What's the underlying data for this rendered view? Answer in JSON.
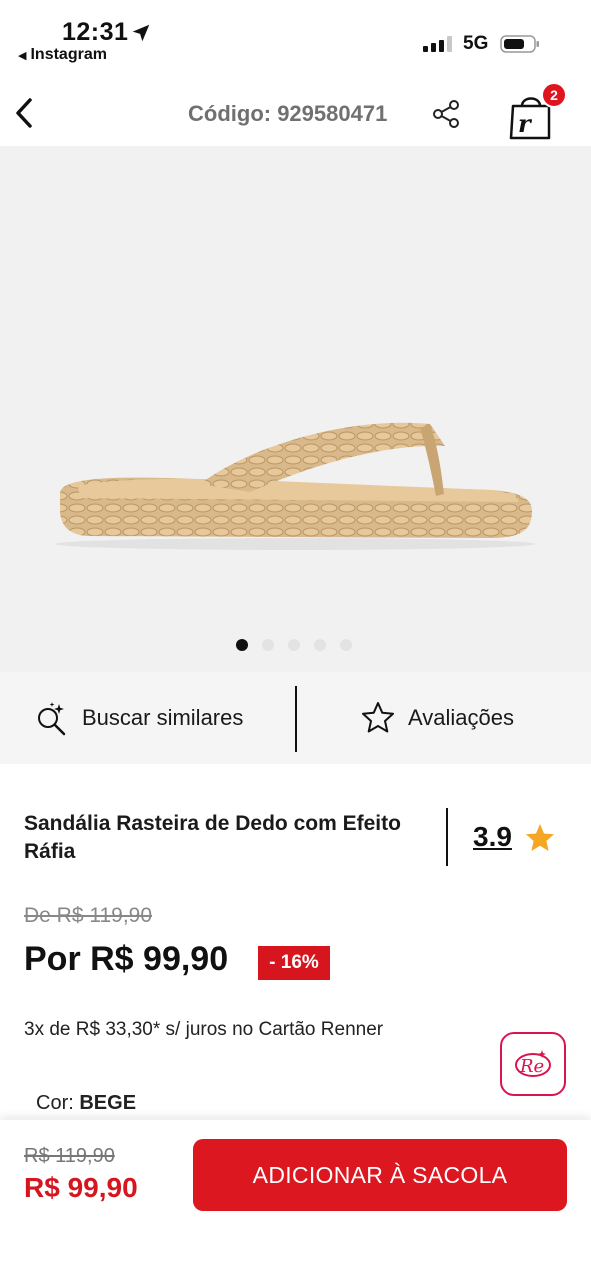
{
  "status_bar": {
    "time": "12:31",
    "back_app": "Instagram",
    "network": "5G"
  },
  "header": {
    "code_label": "Código: 929580471",
    "cart_count": "2"
  },
  "gallery": {
    "image_description": "Sandália rasteira bege com efeito ráfia trançada",
    "total_images": 5,
    "active_index": 0
  },
  "actions": {
    "similar_label": "Buscar similares",
    "reviews_label": "Avaliações"
  },
  "product": {
    "title": "Sandália Rasteira de Dedo com Efeito Ráfia",
    "rating": "3.9",
    "old_price": "De R$ 119,90",
    "new_price": "Por R$ 99,90",
    "discount": "- 16%",
    "installments": "3x de R$ 33,30* s/ juros no Cartão Renner",
    "color_label": "Cor:",
    "color_value": "BEGE"
  },
  "bottom_bar": {
    "old_price": "R$ 119,90",
    "new_price": "R$ 99,90",
    "add_button": "ADICIONAR À SACOLA"
  },
  "colors": {
    "accent": "#dc1720",
    "badge": "#e0141e",
    "rating_star": "#f5a623",
    "re_border": "#d91550"
  }
}
